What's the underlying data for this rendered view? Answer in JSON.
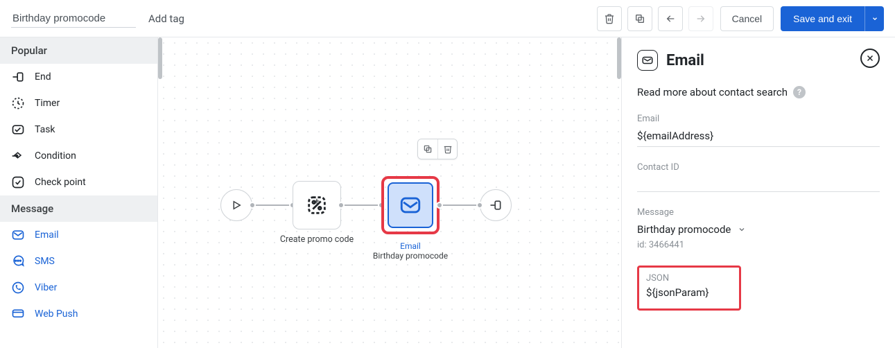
{
  "topbar": {
    "title": "Birthday promocode",
    "add_tag": "Add tag",
    "cancel": "Cancel",
    "save_exit": "Save and exit"
  },
  "sidebar": {
    "sections": [
      {
        "title": "Popular",
        "items": [
          {
            "label": "End"
          },
          {
            "label": "Timer"
          },
          {
            "label": "Task"
          },
          {
            "label": "Condition"
          },
          {
            "label": "Check point"
          }
        ]
      },
      {
        "title": "Message",
        "items": [
          {
            "label": "Email"
          },
          {
            "label": "SMS"
          },
          {
            "label": "Viber"
          },
          {
            "label": "Web Push"
          }
        ]
      }
    ]
  },
  "canvas": {
    "promo_block_label": "Create promo code",
    "email_block_type": "Email",
    "email_block_label": "Birthday promocode"
  },
  "panel": {
    "title": "Email",
    "helper": "Read more about contact search",
    "email_label": "Email",
    "email_value": "${emailAddress}",
    "contact_label": "Contact ID",
    "contact_value": "",
    "message_label": "Message",
    "message_value": "Birthday promocode",
    "message_id": "id: 3466441",
    "json_label": "JSON",
    "json_value": "${jsonParam}"
  }
}
